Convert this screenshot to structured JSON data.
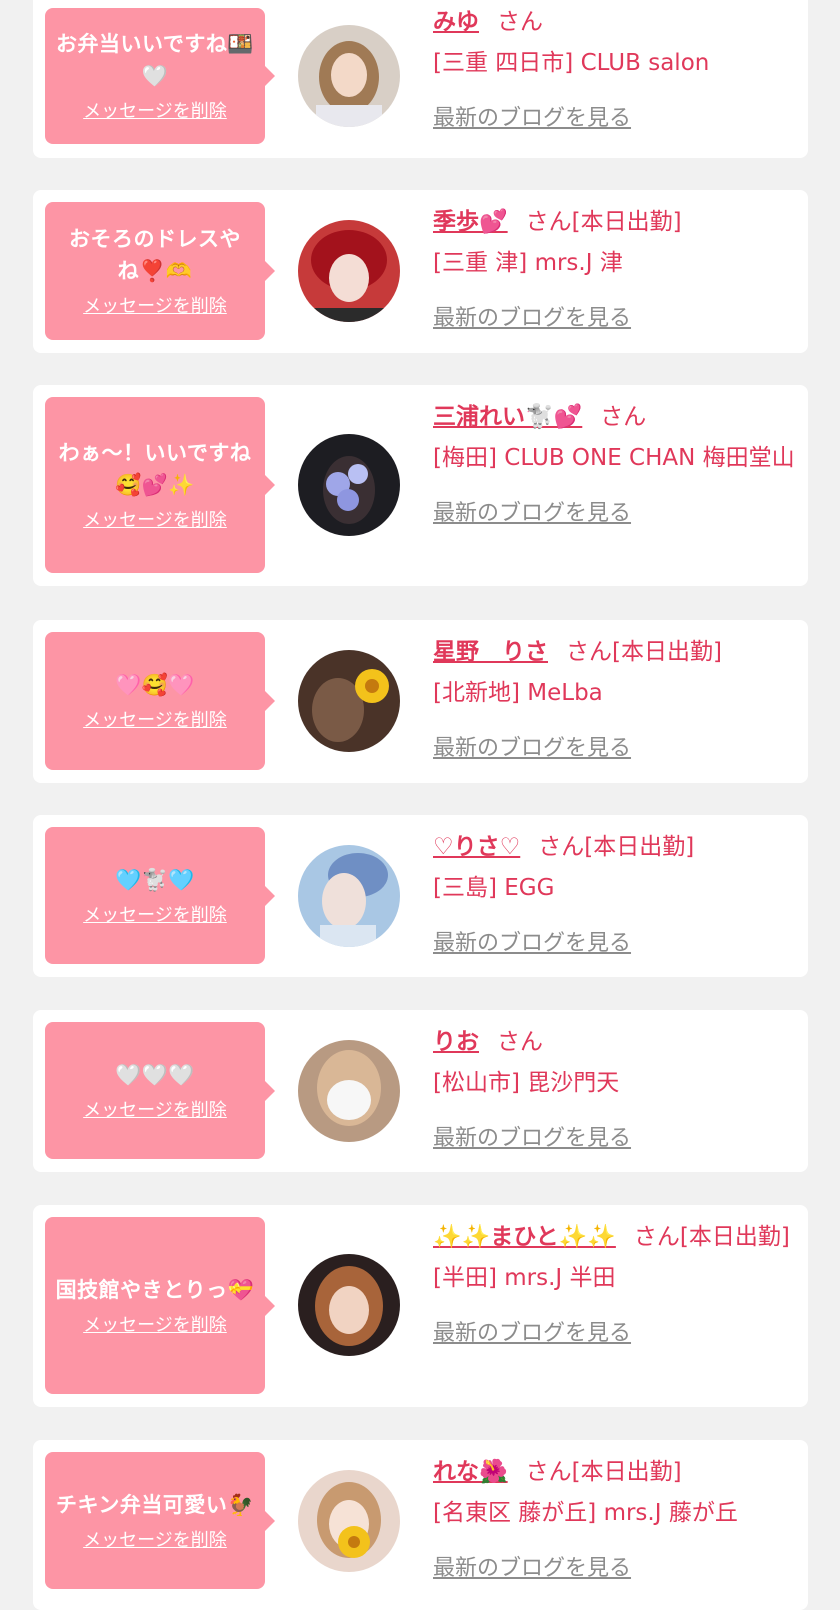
{
  "common": {
    "delete_label": "メッセージを削除",
    "blog_label": "最新のブログを見る"
  },
  "colors": {
    "page_bg": "#f1f1f1",
    "card_bg": "#ffffff",
    "bubble_bg": "#fd95a5",
    "accent": "#e0385a",
    "muted": "#8c8c8c"
  },
  "items": [
    {
      "message": "お弁当いいですね🍱🤍",
      "name": "みゆ",
      "san": "さん",
      "shop": "[三重 四日市] CLUB salon"
    },
    {
      "message": "おそろのドレスやね❣️🫶",
      "name": "季歩💕",
      "san": "さん[本日出勤]",
      "shop": "[三重 津] mrs.J 津"
    },
    {
      "message": "わぁ〜！いいですね🥰💕✨",
      "name": "三浦れい🐩💕",
      "san": "さん",
      "shop": "[梅田] CLUB ONE CHAN 梅田堂山"
    },
    {
      "message": "🩷🥰🩷",
      "name": "星野　りさ",
      "san": "さん[本日出勤]",
      "shop": "[北新地] MeLba"
    },
    {
      "message": "🩵🐩🩵",
      "name": "♡りさ♡",
      "san": "さん[本日出勤]",
      "shop": "[三島] EGG"
    },
    {
      "message": "🤍🤍🤍",
      "name": "りお",
      "san": "さん",
      "shop": "[松山市] 毘沙門天"
    },
    {
      "message": "国技館やきとりっ💝",
      "name": "✨✨まひと✨✨",
      "san": "さん[本日出勤]",
      "shop": "[半田] mrs.J 半田"
    },
    {
      "message": "チキン弁当可愛い🐓",
      "name": "れな🌺",
      "san": "さん[本日出勤]",
      "shop": "[名東区 藤が丘] mrs.J 藤が丘"
    }
  ]
}
